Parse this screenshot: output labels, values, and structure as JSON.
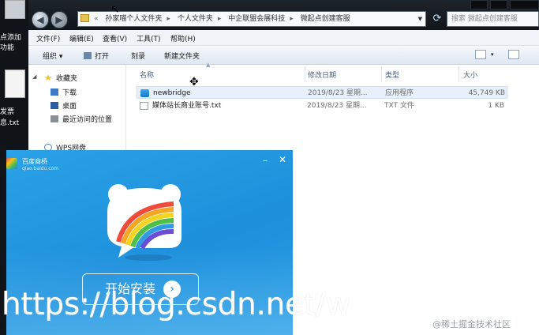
{
  "desktop": {
    "labels": [
      "点添加",
      "功能",
      "发票",
      "息.txt"
    ]
  },
  "window": {
    "breadcrumb": [
      "孙家",
      "孙家喵个人文件夹",
      "个人文件夹",
      "中企联盟会展科技",
      "微起点创建客服"
    ],
    "search_placeholder": "搜索 微起点创建客服",
    "menu": [
      "文件(F)",
      "编辑(E)",
      "查看(V)",
      "工具(T)",
      "帮助(H)"
    ],
    "toolbar": {
      "organize": "组织 ▾",
      "open": "打开",
      "burn": "刻录",
      "new_folder": "新建文件夹"
    },
    "nav": {
      "favorites": "收藏夹",
      "downloads": "下载",
      "desktop": "桌面",
      "recent": "最近访问的位置",
      "wps": "WPS网盘"
    },
    "columns": [
      "名称",
      "修改日期",
      "类型",
      "大小"
    ],
    "files": [
      {
        "name": "newbridge",
        "date": "2019/8/23 星期...",
        "type": "应用程序",
        "size": "45,749 KB"
      },
      {
        "name": "媒体站长商业账号.txt",
        "date": "2019/8/23 星期...",
        "type": "TXT 文件",
        "size": "1 KB"
      }
    ]
  },
  "installer": {
    "brand": "百度商桥",
    "url": "qiao.baidu.com",
    "minimize": "–",
    "close": "✕",
    "cta": "开始安装",
    "cta_arrow": "›"
  },
  "watermark": {
    "url": "https://blog.csdn.net/w",
    "credit": "@稀土掘金技术社区"
  },
  "colors": {
    "popup_blue": "#1e90dc",
    "titlebar": "#151a20",
    "selection": "#e7f0fb"
  }
}
